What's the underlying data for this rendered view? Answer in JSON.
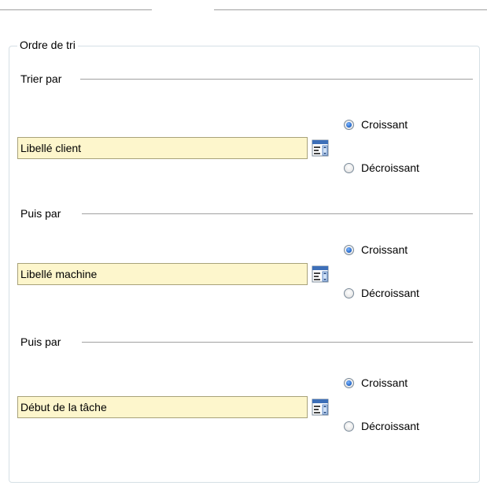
{
  "groupbox": {
    "title": "Ordre de tri"
  },
  "sections": [
    {
      "label": "Trier par",
      "field_value": "Libellé client",
      "ascending_label": "Croissant",
      "descending_label": "Décroissant",
      "selected": "ascending"
    },
    {
      "label": "Puis par",
      "field_value": "Libellé machine",
      "ascending_label": "Croissant",
      "descending_label": "Décroissant",
      "selected": "ascending"
    },
    {
      "label": "Puis par",
      "field_value": "Début de la tâche",
      "ascending_label": "Croissant",
      "descending_label": "Décroissant",
      "selected": "ascending"
    }
  ],
  "icons": {
    "picker": "list-picker-icon"
  },
  "colors": {
    "field_background": "#fdf6cc",
    "radio_selected": "#1f63c6"
  }
}
